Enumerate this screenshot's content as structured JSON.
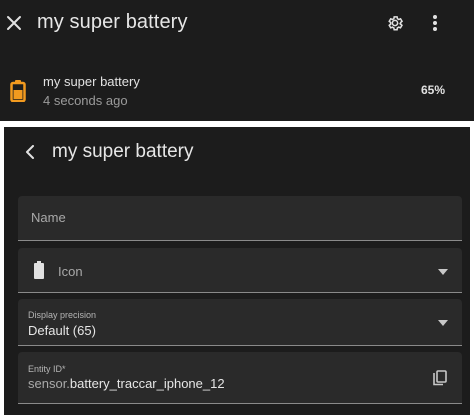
{
  "more_info_dialog": {
    "title": "my super battery",
    "entity": {
      "name": "my super battery",
      "last_changed": "4 seconds ago",
      "state": "65%",
      "state_percent": 65,
      "icon": "battery-60-icon",
      "icon_color": "#f29a1f"
    }
  },
  "settings_panel": {
    "title": "my super battery",
    "fields": {
      "name": {
        "label": "Name",
        "value": ""
      },
      "icon": {
        "label": "Icon",
        "icon": "battery-full-icon"
      },
      "display_precision": {
        "label": "Display precision",
        "value": "Default (65)"
      },
      "entity_id": {
        "label": "Entity ID*",
        "prefix": "sensor.",
        "value": "battery_traccar_iphone_12"
      }
    }
  },
  "colors": {
    "background": "#1c1c1c",
    "field_background": "#2a2a2a",
    "battery_accent": "#f29a1f"
  }
}
